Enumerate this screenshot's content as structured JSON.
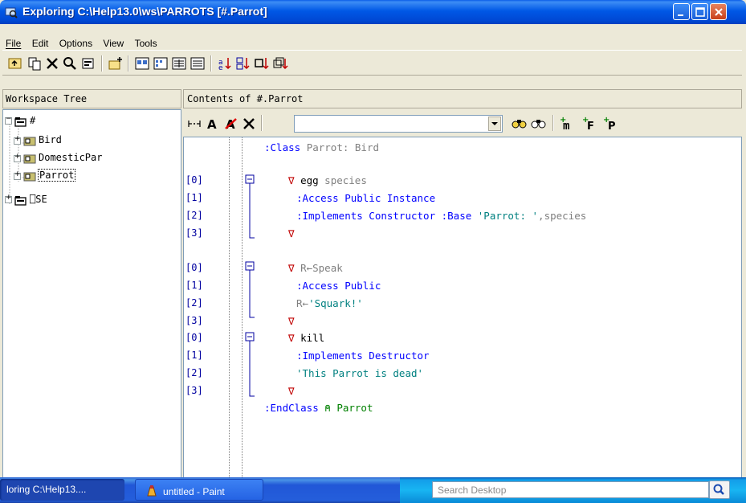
{
  "window": {
    "title": "Exploring C:\\Help13.0\\ws\\PARROTS [#.Parrot]"
  },
  "menu": [
    "File",
    "Edit",
    "Options",
    "View",
    "Tools"
  ],
  "panels": {
    "left_header": "Workspace Tree",
    "right_header": "Contents of #.Parrot"
  },
  "tree": {
    "root": "#",
    "children": [
      "Bird",
      "DomesticPar",
      "Parrot"
    ],
    "selected": "Parrot",
    "second_root": "⎕SE"
  },
  "editor_toolbar": {
    "search_value": ""
  },
  "code": {
    "class_line": [
      ":Class",
      "Parrot:",
      "Bird"
    ],
    "line_numbers": [
      "[0]",
      "[1]",
      "[2]",
      "[3]",
      "[0]",
      "[1]",
      "[2]",
      "[3]",
      "[0]",
      "[1]",
      "[2]",
      "[3]"
    ],
    "lines": [
      {
        "del": "∇",
        "text": "egg",
        "extra": "species"
      },
      {
        "text": ":Access Public Instance"
      },
      {
        "text": ":Implements Constructor :Base",
        "str": "'Parrot: '",
        "tail": ",species"
      },
      {
        "del": "∇"
      },
      {
        "del": "∇",
        "text": "R←Speak"
      },
      {
        "text": ":Access Public"
      },
      {
        "text": "R←",
        "str": "'Squark!'"
      },
      {
        "del": "∇"
      },
      {
        "del": "∇",
        "text": "kill"
      },
      {
        "text": ":Implements Destructor"
      },
      {
        "str": "'This Parrot is dead'"
      },
      {
        "del": "∇"
      }
    ],
    "end_line": [
      ":EndClass",
      "⍝",
      "Parrot"
    ]
  },
  "taskbar": {
    "task1": "loring C:\\Help13....",
    "task2": "untitled - Paint",
    "search_placeholder": "Search Desktop"
  },
  "colors": {
    "title_blue": "#0058e6",
    "keyword_blue": "#0000ff",
    "string_teal": "#008080",
    "comment_green": "#008000",
    "del_red": "#c00000"
  }
}
